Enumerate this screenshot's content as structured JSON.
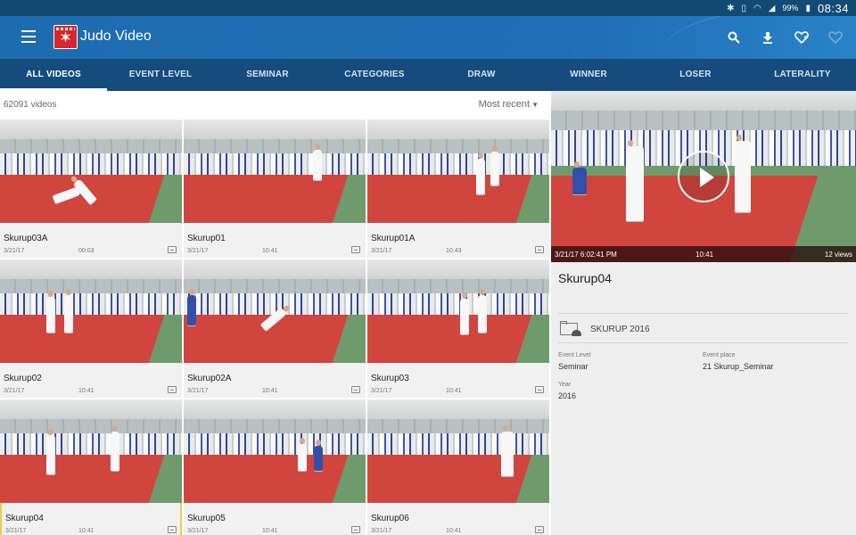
{
  "status_bar": {
    "battery": "99%",
    "time": "08:34",
    "icons": [
      "bluetooth-icon",
      "vibrate-icon",
      "wifi-icon",
      "signal-icon",
      "battery-icon"
    ]
  },
  "app_bar": {
    "title": "Judo Video",
    "icons": [
      "menu-icon",
      "search-icon",
      "download-icon",
      "heart-add-icon",
      "heart-icon"
    ]
  },
  "tabs": [
    {
      "label": "ALL VIDEOS",
      "active": true
    },
    {
      "label": "EVENT LEVEL",
      "active": false
    },
    {
      "label": "SEMINAR",
      "active": false
    },
    {
      "label": "CATEGORIES",
      "active": false
    },
    {
      "label": "DRAW",
      "active": false
    },
    {
      "label": "WINNER",
      "active": false
    },
    {
      "label": "LOSER",
      "active": false
    },
    {
      "label": "LATERALITY",
      "active": false
    }
  ],
  "list": {
    "count": "62091 videos",
    "sort": "Most recent"
  },
  "videos": [
    {
      "name": "Skurup03A",
      "date": "3/21/17",
      "duration": "00:03"
    },
    {
      "name": "Skurup01",
      "date": "3/21/17",
      "duration": "10:41"
    },
    {
      "name": "Skurup01A",
      "date": "3/21/17",
      "duration": "10:43"
    },
    {
      "name": "Skurup02",
      "date": "3/21/17",
      "duration": "10:41"
    },
    {
      "name": "Skurup02A",
      "date": "3/21/17",
      "duration": "10:41"
    },
    {
      "name": "Skurup03",
      "date": "3/21/17",
      "duration": "10:41"
    },
    {
      "name": "Skurup04",
      "date": "3/21/17",
      "duration": "10:41",
      "selected": true
    },
    {
      "name": "Skurup05",
      "date": "3/21/17",
      "duration": "10:41"
    },
    {
      "name": "Skurup06",
      "date": "3/21/17",
      "duration": "10:41"
    }
  ],
  "detail": {
    "player_date": "3/21/17 6:02:41 PM",
    "player_duration": "10:41",
    "player_views": "12 views",
    "title": "Skurup04",
    "folder": "SKURUP 2016",
    "event_level_label": "Event Level",
    "event_level_value": "Seminar",
    "event_place_label": "Event place",
    "event_place_value": "21 Skurup_Seminar",
    "year_label": "Year",
    "year_value": "2016"
  },
  "colors": {
    "status_bar": "#134a74",
    "app_bar": "#1f6fb4",
    "tab_bar": "#154c7d",
    "selected_outline": "#f2c94c"
  }
}
